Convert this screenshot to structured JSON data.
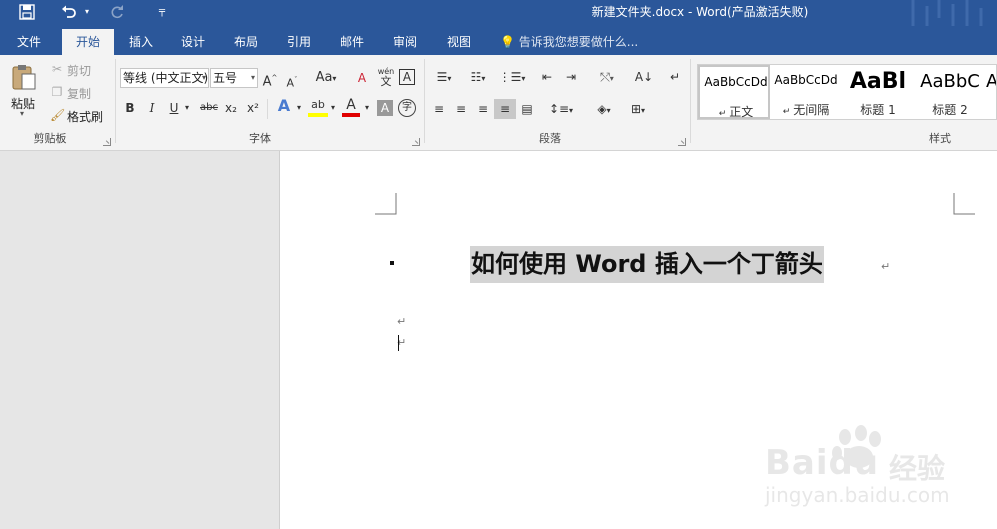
{
  "titlebar": {
    "document_title": "新建文件夹.docx - Word(产品激活失败)",
    "quick_access": {
      "save": "save-icon",
      "undo": "undo-icon",
      "redo": "redo-icon",
      "customize": "customize-icon"
    }
  },
  "tabs": [
    {
      "label": "文件"
    },
    {
      "label": "开始"
    },
    {
      "label": "插入"
    },
    {
      "label": "设计"
    },
    {
      "label": "布局"
    },
    {
      "label": "引用"
    },
    {
      "label": "邮件"
    },
    {
      "label": "审阅"
    },
    {
      "label": "视图"
    }
  ],
  "active_tab": "开始",
  "tell_me": "告诉我您想要做什么...",
  "clipboard": {
    "paste": "粘贴",
    "cut": "剪切",
    "copy": "复制",
    "format_painter": "格式刷",
    "group_label": "剪贴板"
  },
  "font": {
    "font_name": "等线 (中文正文)",
    "font_size": "五号",
    "grow": "A",
    "shrink": "A",
    "case": "Aa",
    "clear": "A",
    "phonetic": "wén",
    "border_char": "A",
    "bold": "B",
    "italic": "I",
    "underline": "U",
    "strike": "abc",
    "subscript": "x₂",
    "superscript": "x²",
    "effects": "A",
    "highlight": "ab",
    "font_color": "A",
    "shading": "A",
    "enclose": "字",
    "group_label": "字体"
  },
  "paragraph": {
    "group_label": "段落"
  },
  "styles": {
    "items": [
      {
        "preview": "AaBbCcDd",
        "name": "正文",
        "selected": true
      },
      {
        "preview": "AaBbCcDd",
        "name": "无间隔"
      },
      {
        "preview": "AaBl",
        "name": "标题 1"
      },
      {
        "preview": "AaBbC",
        "name": "标题 2"
      },
      {
        "preview": "A",
        "name": ""
      }
    ],
    "group_label": "样式"
  },
  "document": {
    "heading": "如何使用 Word 插入一个丁箭头",
    "paragraph_mark": "↵"
  },
  "watermark": {
    "brand": "Baidu",
    "subtitle": "经验",
    "url": "jingyan.baidu.com"
  },
  "colors": {
    "brand": "#2b579a",
    "highlight": "#ffff00",
    "font_color": "#e00000"
  }
}
